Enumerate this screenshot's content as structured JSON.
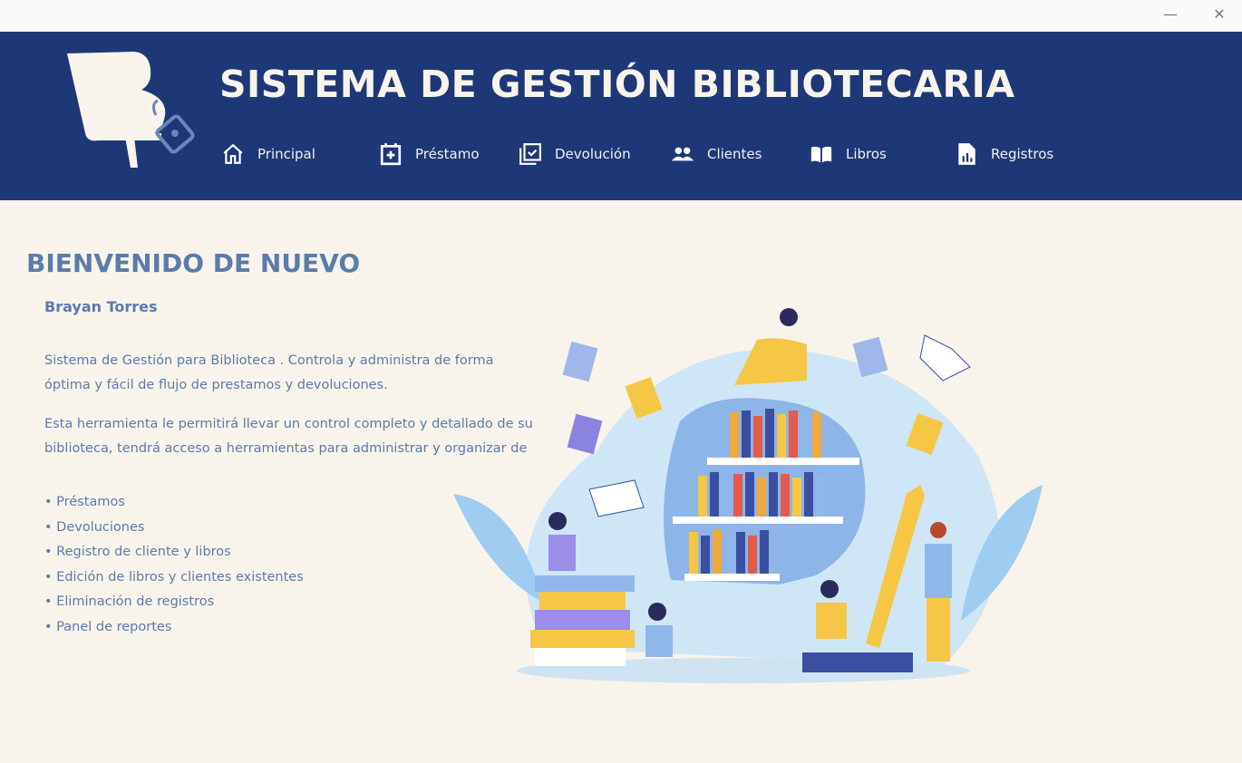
{
  "window": {
    "minimize_icon": "minimize-icon",
    "close_icon": "close-icon"
  },
  "header": {
    "title": "SISTEMA DE GESTIÓN BIBLIOTECARIA",
    "nav": [
      {
        "label": "Principal",
        "icon": "home-icon"
      },
      {
        "label": "Préstamo",
        "icon": "calendar-plus-icon"
      },
      {
        "label": "Devolución",
        "icon": "calendar-check-icon"
      },
      {
        "label": "Clientes",
        "icon": "users-icon"
      },
      {
        "label": "Libros",
        "icon": "book-open-icon"
      },
      {
        "label": "Registros",
        "icon": "report-icon"
      }
    ]
  },
  "main": {
    "heading": "BIENVENIDO DE NUEVO",
    "user_name": "Brayan Torres",
    "paragraph1": "Sistema de Gestión para Biblioteca . Controla y administra de forma óptima y fácil de flujo de prestamos y devoluciones.",
    "paragraph2": "Esta herramienta le permitirá llevar un control completo y detallado de su biblioteca, tendrá acceso a herramientas para administrar y organizar de",
    "features": [
      "• Préstamos",
      "• Devoluciones",
      "• Registro de cliente y libros",
      "• Edición de libros y clientes existentes",
      "• Eliminación de registros",
      "• Panel de reportes"
    ]
  },
  "colors": {
    "header": "#1e3777",
    "background": "#f8f4eb",
    "text": "#5b7bab"
  }
}
